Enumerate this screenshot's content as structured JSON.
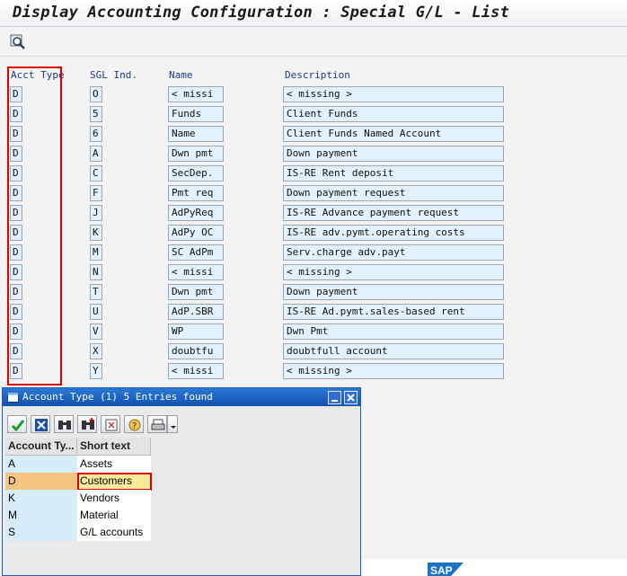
{
  "window": {
    "title": "Display Accounting Configuration : Special G/L - List"
  },
  "columns": {
    "acct_type": "Acct Type",
    "sgl_ind": "SGL Ind.",
    "name": "Name",
    "description": "Description"
  },
  "rows": [
    {
      "acct": "D",
      "sgl": "O",
      "name": "< missi",
      "desc": "< missing >"
    },
    {
      "acct": "D",
      "sgl": "5",
      "name": "Funds",
      "desc": "Client Funds"
    },
    {
      "acct": "D",
      "sgl": "6",
      "name": "Name",
      "desc": "Client Funds Named Account"
    },
    {
      "acct": "D",
      "sgl": "A",
      "name": "Dwn pmt",
      "desc": "Down payment"
    },
    {
      "acct": "D",
      "sgl": "C",
      "name": "SecDep.",
      "desc": "IS-RE Rent deposit"
    },
    {
      "acct": "D",
      "sgl": "F",
      "name": "Pmt req",
      "desc": "Down payment request"
    },
    {
      "acct": "D",
      "sgl": "J",
      "name": "AdPyReq",
      "desc": "IS-RE Advance payment request"
    },
    {
      "acct": "D",
      "sgl": "K",
      "name": "AdPy OC",
      "desc": "IS-RE adv.pymt.operating costs"
    },
    {
      "acct": "D",
      "sgl": "M",
      "name": "SC AdPm",
      "desc": "Serv.charge adv.payt"
    },
    {
      "acct": "D",
      "sgl": "N",
      "name": "< missi",
      "desc": "< missing >"
    },
    {
      "acct": "D",
      "sgl": "T",
      "name": "Dwn pmt",
      "desc": "Down payment"
    },
    {
      "acct": "D",
      "sgl": "U",
      "name": "AdP.SBR",
      "desc": "IS-RE Ad.pymt.sales-based rent"
    },
    {
      "acct": "D",
      "sgl": "V",
      "name": "WP",
      "desc": "Dwn Pmt"
    },
    {
      "acct": "D",
      "sgl": "X",
      "name": "doubtfu",
      "desc": "doubtfull account"
    },
    {
      "acct": "D",
      "sgl": "Y",
      "name": "< missi",
      "desc": "< missing >"
    }
  ],
  "popup": {
    "title": "Account Type (1)   5 Entries found",
    "col_key": "Account Ty...",
    "col_text": "Short text",
    "entries": [
      {
        "key": "A",
        "text": "Assets"
      },
      {
        "key": "D",
        "text": "Customers"
      },
      {
        "key": "K",
        "text": "Vendors"
      },
      {
        "key": "M",
        "text": "Material"
      },
      {
        "key": "S",
        "text": "G/L accounts"
      }
    ],
    "selected_index": 1
  },
  "brand": {
    "logo": "SAP"
  },
  "colors": {
    "highlight": "#e00000",
    "title_blue": "#1352b2",
    "field_bg": "#e2f1fb",
    "selected": "#f8ea9b"
  }
}
